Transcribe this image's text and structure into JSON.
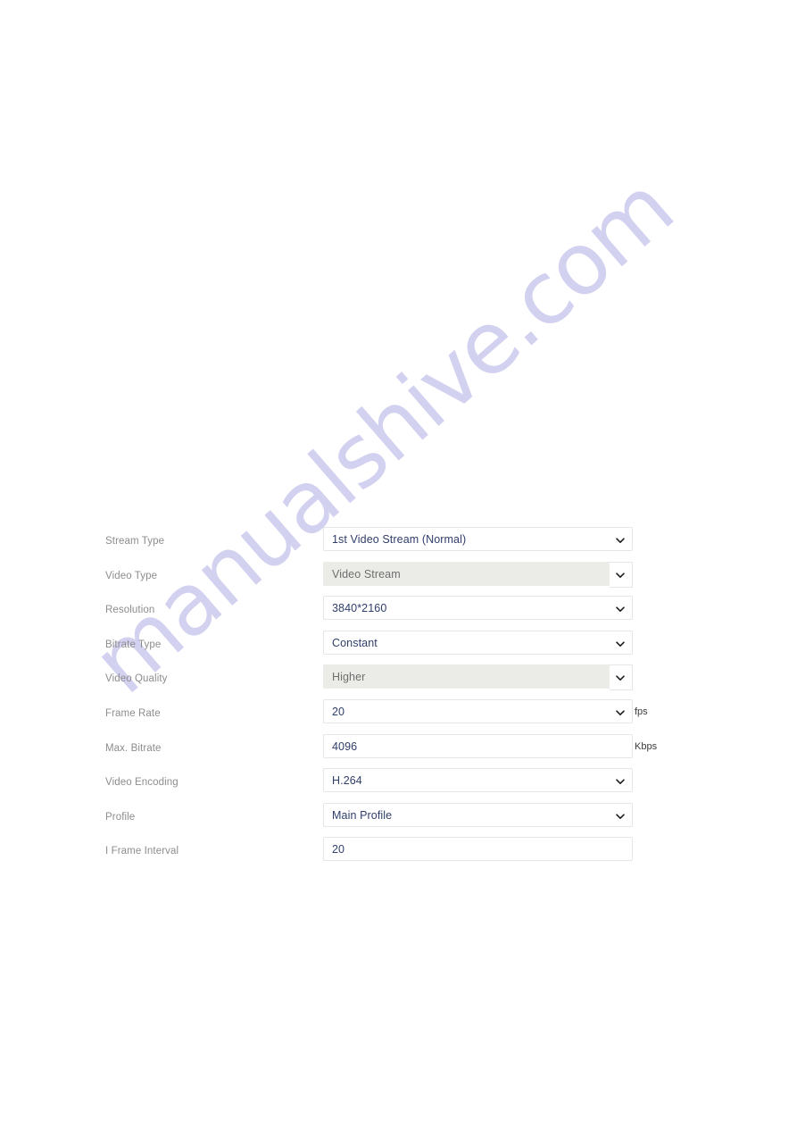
{
  "watermark": {
    "text": "manualshive.com"
  },
  "form": {
    "name": "video-stream-settings",
    "rows": [
      {
        "label": "Stream Type",
        "value": "1st Video Stream (Normal)",
        "control": "select",
        "disabled": false,
        "unit": ""
      },
      {
        "label": "Video Type",
        "value": "Video Stream",
        "control": "select",
        "disabled": true,
        "unit": ""
      },
      {
        "label": "Resolution",
        "value": "3840*2160",
        "control": "select",
        "disabled": false,
        "unit": ""
      },
      {
        "label": "Bitrate Type",
        "value": "Constant",
        "control": "select",
        "disabled": false,
        "unit": ""
      },
      {
        "label": "Video Quality",
        "value": "Higher",
        "control": "select",
        "disabled": true,
        "unit": ""
      },
      {
        "label": "Frame Rate",
        "value": "20",
        "control": "select",
        "disabled": false,
        "unit": "fps"
      },
      {
        "label": "Max. Bitrate",
        "value": "4096",
        "control": "input",
        "disabled": false,
        "unit": "Kbps"
      },
      {
        "label": "Video Encoding",
        "value": "H.264",
        "control": "select",
        "disabled": false,
        "unit": ""
      },
      {
        "label": "Profile",
        "value": "Main Profile",
        "control": "select",
        "disabled": false,
        "unit": ""
      },
      {
        "label": "I Frame Interval",
        "value": "20",
        "control": "input",
        "disabled": false,
        "unit": ""
      }
    ]
  },
  "colors": {
    "value_text": "#2f3e6b",
    "label_text": "#8d8d8d",
    "disabled_bg": "#ebebe7",
    "disabled_text": "#6f6f6f",
    "field_border": "#e6e6ea",
    "watermark": "#b9b5e8",
    "page_bg": "#ffffff"
  }
}
